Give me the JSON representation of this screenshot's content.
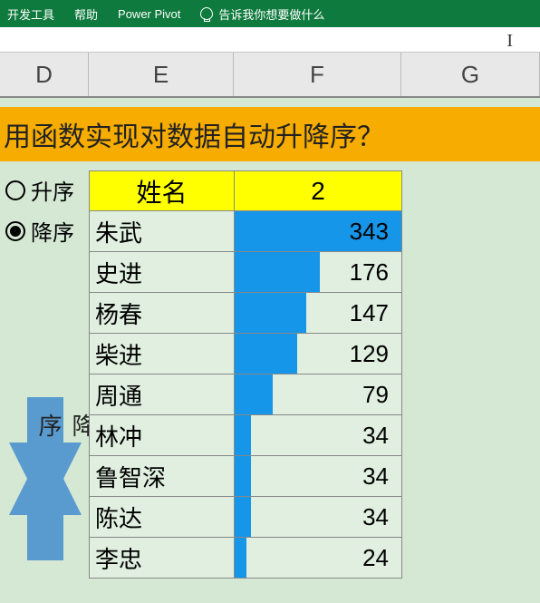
{
  "ribbon": {
    "dev_tools": "开发工具",
    "help": "帮助",
    "power_pivot": "Power Pivot",
    "tell_me": "告诉我你想要做什么"
  },
  "columns": {
    "D": "D",
    "E": "E",
    "F": "F",
    "G": "G"
  },
  "title_text": "用函数实现对数据自动升降序？",
  "radios": {
    "asc_label": "升序",
    "desc_label": "降序",
    "selected": "desc"
  },
  "arrow_label": "升降序",
  "table": {
    "header_name": "姓名",
    "header_value": "2",
    "rows": [
      {
        "name": "朱武",
        "value": 343
      },
      {
        "name": "史进",
        "value": 176
      },
      {
        "name": "杨春",
        "value": 147
      },
      {
        "name": "柴进",
        "value": 129
      },
      {
        "name": "周通",
        "value": 79
      },
      {
        "name": "林冲",
        "value": 34
      },
      {
        "name": "鲁智深",
        "value": 34
      },
      {
        "name": "陈达",
        "value": 34
      },
      {
        "name": "李忠",
        "value": 24
      }
    ]
  },
  "chart_data": {
    "type": "bar",
    "title": "用函数实现对数据自动升降序？",
    "categories": [
      "朱武",
      "史进",
      "杨春",
      "柴进",
      "周通",
      "林冲",
      "鲁智深",
      "陈达",
      "李忠"
    ],
    "values": [
      343,
      176,
      147,
      129,
      79,
      34,
      34,
      34,
      24
    ],
    "xlabel": "",
    "ylabel": "",
    "ylim": [
      0,
      343
    ]
  }
}
